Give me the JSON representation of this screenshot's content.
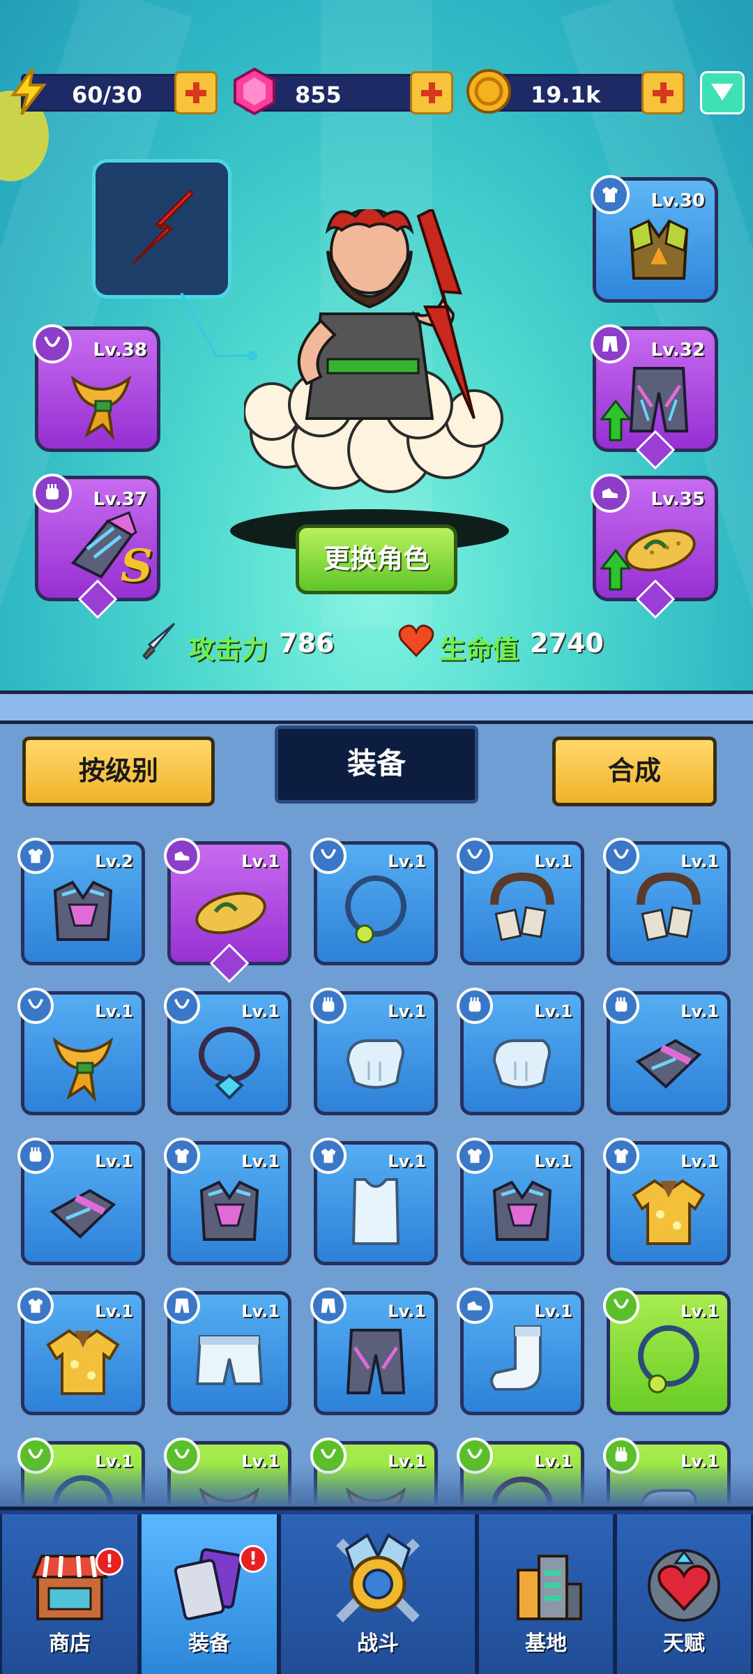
{
  "resources": {
    "energy": "60/30",
    "gems": "855",
    "coins": "19.1k"
  },
  "colors": {
    "hero_bg": "#4fd9cf",
    "purple_rarity": "#9731d3",
    "blue_rarity": "#2d81d8",
    "green_rarity": "#6acd25",
    "button_yellow": "#f6c33a",
    "button_green": "#5fc628"
  },
  "equipped": {
    "left": [
      {
        "level": "Lv.38",
        "category_icon": "necklace-icon",
        "item_icon": "scarf-icon",
        "rarity": "purple"
      },
      {
        "level": "Lv.37",
        "category_icon": "glove-icon",
        "item_icon": "gauntlet-icon",
        "rarity": "purple",
        "grade": "S"
      }
    ],
    "right": [
      {
        "level": "Lv.30",
        "category_icon": "armor-icon",
        "item_icon": "armor-vest-icon",
        "rarity": "blue"
      },
      {
        "level": "Lv.32",
        "category_icon": "pants-icon",
        "item_icon": "armor-pants-icon",
        "rarity": "purple"
      },
      {
        "level": "Lv.35",
        "category_icon": "shoe-icon",
        "item_icon": "flip-flop-icon",
        "rarity": "purple"
      }
    ],
    "skill_icon": "lightning-icon"
  },
  "change_character_label": "更换角色",
  "stats": {
    "attack_label": "攻击力",
    "attack_value": "786",
    "hp_label": "生命值",
    "hp_value": "2740"
  },
  "inventory_tabs": {
    "by_level": "按级别",
    "equipment": "装备",
    "merge": "合成"
  },
  "inventory": [
    {
      "level": "Lv.2",
      "rarity": "blue",
      "category_icon": "armor-icon",
      "item_icon": "armor-vest-icon"
    },
    {
      "level": "Lv.1",
      "rarity": "purple",
      "category_icon": "shoe-icon",
      "item_icon": "flip-flop-icon"
    },
    {
      "level": "Lv.1",
      "rarity": "blue",
      "category_icon": "necklace-icon",
      "item_icon": "pendant-necklace-icon"
    },
    {
      "level": "Lv.1",
      "rarity": "blue",
      "category_icon": "necklace-icon",
      "item_icon": "tag-necklace-icon"
    },
    {
      "level": "Lv.1",
      "rarity": "blue",
      "category_icon": "necklace-icon",
      "item_icon": "tag-necklace-icon"
    },
    {
      "level": "Lv.1",
      "rarity": "blue",
      "category_icon": "necklace-icon",
      "item_icon": "scarf-icon"
    },
    {
      "level": "Lv.1",
      "rarity": "blue",
      "category_icon": "necklace-icon",
      "item_icon": "gem-necklace-icon"
    },
    {
      "level": "Lv.1",
      "rarity": "blue",
      "category_icon": "glove-icon",
      "item_icon": "white-glove-icon"
    },
    {
      "level": "Lv.1",
      "rarity": "blue",
      "category_icon": "glove-icon",
      "item_icon": "white-glove-icon"
    },
    {
      "level": "Lv.1",
      "rarity": "blue",
      "category_icon": "glove-icon",
      "item_icon": "gauntlet-icon"
    },
    {
      "level": "Lv.1",
      "rarity": "blue",
      "category_icon": "glove-icon",
      "item_icon": "gauntlet-icon"
    },
    {
      "level": "Lv.1",
      "rarity": "blue",
      "category_icon": "armor-icon",
      "item_icon": "armor-vest-icon"
    },
    {
      "level": "Lv.1",
      "rarity": "blue",
      "category_icon": "armor-icon",
      "item_icon": "tank-top-icon"
    },
    {
      "level": "Lv.1",
      "rarity": "blue",
      "category_icon": "armor-icon",
      "item_icon": "armor-vest-icon"
    },
    {
      "level": "Lv.1",
      "rarity": "blue",
      "category_icon": "armor-icon",
      "item_icon": "hawaiian-shirt-icon"
    },
    {
      "level": "Lv.1",
      "rarity": "blue",
      "category_icon": "armor-icon",
      "item_icon": "hawaiian-shirt-icon"
    },
    {
      "level": "Lv.1",
      "rarity": "blue",
      "category_icon": "pants-icon",
      "item_icon": "shorts-icon"
    },
    {
      "level": "Lv.1",
      "rarity": "blue",
      "category_icon": "pants-icon",
      "item_icon": "armor-pants-icon"
    },
    {
      "level": "Lv.1",
      "rarity": "blue",
      "category_icon": "shoe-icon",
      "item_icon": "sock-icon"
    },
    {
      "level": "Lv.1",
      "rarity": "green",
      "category_icon": "necklace-icon",
      "item_icon": "pendant-necklace-icon"
    },
    {
      "level": "Lv.1",
      "rarity": "green",
      "category_icon": "necklace-icon",
      "item_icon": "pendant-necklace-icon"
    },
    {
      "level": "Lv.1",
      "rarity": "green",
      "category_icon": "necklace-icon",
      "item_icon": "scarf-icon"
    },
    {
      "level": "Lv.1",
      "rarity": "green",
      "category_icon": "necklace-icon",
      "item_icon": "scarf-icon"
    },
    {
      "level": "Lv.1",
      "rarity": "green",
      "category_icon": "necklace-icon",
      "item_icon": "gem-necklace-icon"
    },
    {
      "level": "Lv.1",
      "rarity": "green",
      "category_icon": "glove-icon",
      "item_icon": "white-glove-icon"
    }
  ],
  "nav": {
    "shop": "商店",
    "equipment": "装备",
    "battle": "战斗",
    "base": "基地",
    "talent": "天赋",
    "badge": "!"
  }
}
